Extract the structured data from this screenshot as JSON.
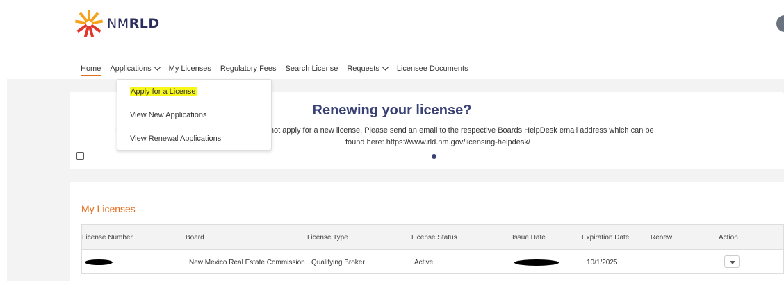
{
  "header": {
    "logo_text_prefix": "NM",
    "logo_text_suffix": "RLD",
    "logo_colors": [
      "#f7a21b",
      "#e2382b",
      "#2b2d5c"
    ]
  },
  "nav": {
    "items": [
      {
        "label": "Home",
        "active": true
      },
      {
        "label": "Applications",
        "has_dropdown": true
      },
      {
        "label": "My Licenses"
      },
      {
        "label": "Regulatory Fees"
      },
      {
        "label": "Search License"
      },
      {
        "label": "Requests",
        "has_dropdown": true
      },
      {
        "label": "Licensee Documents"
      }
    ],
    "accent_color": "#e26d1d"
  },
  "dropdown": {
    "items": [
      {
        "label": "Apply for a License",
        "highlighted": true
      },
      {
        "label": "View New Applications"
      },
      {
        "label": "View Renewal Applications"
      }
    ]
  },
  "banner": {
    "title": "Renewing your license?",
    "text_prefix": "I",
    "text_line1": "ur license, do not apply for a new license. Please send an email to the respective Boards HelpDesk email address which can be",
    "text_line2": "found here: https://www.rld.nm.gov/licensing-helpdesk/"
  },
  "licenses": {
    "title": "My Licenses",
    "columns": [
      "License Number",
      "Board",
      "License Type",
      "License Status",
      "Issue Date",
      "Expiration Date",
      "Renew",
      "Action"
    ],
    "rows": [
      {
        "license_number": "",
        "board": "New Mexico Real Estate Commission",
        "license_type": "Qualifying Broker",
        "license_status": "Active",
        "issue_date": "",
        "expiration_date": "10/1/2025",
        "renew": ""
      }
    ]
  }
}
